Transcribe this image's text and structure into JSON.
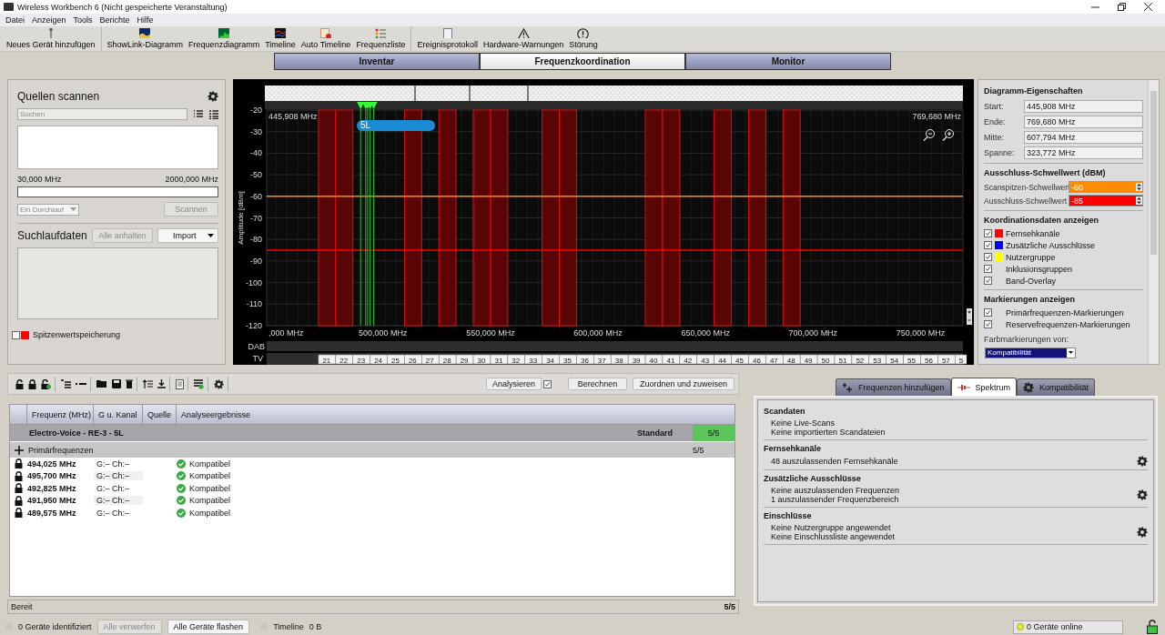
{
  "window": {
    "title": "Wireless Workbench 6 (Nicht gespeicherte Veranstaltung)"
  },
  "menu": [
    "Datei",
    "Anzeigen",
    "Tools",
    "Berichte",
    "Hilfe"
  ],
  "toolbar_groups": [
    [
      {
        "label": "Neues Gerät hinzufügen",
        "kind": "mic"
      }
    ],
    [
      {
        "label": "ShowLink-Diagramm",
        "kind": "showlink"
      },
      {
        "label": "Frequenzdiagramm",
        "kind": "spectrum"
      },
      {
        "label": "Timeline",
        "kind": "timeline"
      },
      {
        "label": "Auto Timeline",
        "kind": "autotimeline"
      },
      {
        "label": "Frequenzliste",
        "kind": "list"
      }
    ],
    [
      {
        "label": "Ereignisprotokoll",
        "kind": "log"
      },
      {
        "label": "Hardware-Warnungen",
        "kind": "warning"
      },
      {
        "label": "Störung",
        "kind": "alert"
      }
    ]
  ],
  "main_tabs": [
    {
      "label": "Inventar",
      "selected": false
    },
    {
      "label": "Frequenzkoordination",
      "selected": true
    },
    {
      "label": "Monitor",
      "selected": false
    }
  ],
  "scan_sources": {
    "title": "Quellen scannen",
    "search_placeholder": "Suchen",
    "range_start": "30,000 MHz",
    "range_end": "2000,000 MHz",
    "mode": {
      "value": "Ein Durchlauf",
      "disabled": true
    },
    "scan_button": {
      "label": "Scannen",
      "disabled": true
    }
  },
  "scan_data": {
    "title": "Suchlaufdaten",
    "stop_button": {
      "label": "Alle anhalten",
      "disabled": true
    },
    "import_button": "Import",
    "peak_hold": {
      "label": "Spitzenwertspeicherung",
      "checked": false,
      "color": "#ff0000"
    }
  },
  "spectrum": {
    "start_label": "445,908 MHz",
    "end_label": "769,680 MHz",
    "band_tag": "5L",
    "dab_label": "DAB",
    "tv_label": "TV",
    "tv_channels": [
      "21",
      "22",
      "23",
      "24",
      "25",
      "26",
      "27",
      "28",
      "29",
      "30",
      "31",
      "32",
      "33",
      "34",
      "35",
      "36",
      "37",
      "38",
      "39",
      "40",
      "41",
      "42",
      "43",
      "44",
      "45",
      "46",
      "47",
      "48",
      "49",
      "50",
      "51",
      "52",
      "53",
      "54",
      "55",
      "56",
      "57",
      "5"
    ],
    "cut_tick_label": ",000 MHz",
    "chart_data": {
      "type": "line",
      "ylabel": "Amplitude [dBm]",
      "grid": true,
      "xlim": [
        445908,
        769680
      ],
      "ylim": [
        -120,
        -20
      ],
      "xticks": [
        {
          "value": 500000,
          "label": "500,000 MHz"
        },
        {
          "value": 550000,
          "label": "550,000 MHz"
        },
        {
          "value": 600000,
          "label": "600,000 MHz"
        },
        {
          "value": 650000,
          "label": "650,000 MHz"
        },
        {
          "value": 700000,
          "label": "700,000 MHz"
        },
        {
          "value": 750000,
          "label": "750,000 MHz"
        }
      ],
      "yticks": [
        -20,
        -30,
        -40,
        -50,
        -60,
        -70,
        -80,
        -90,
        -100,
        -110,
        -120
      ],
      "ref_lines": [
        {
          "axis": "y",
          "value": -60,
          "color": "#ff8c00"
        },
        {
          "axis": "y",
          "value": -85,
          "color": "#ff0000"
        },
        {
          "axis": "x",
          "value": 489575,
          "color": "#22cc22"
        },
        {
          "axis": "x",
          "value": 491950,
          "color": "#22cc22"
        },
        {
          "axis": "x",
          "value": 492825,
          "color": "#22cc22"
        },
        {
          "axis": "x",
          "value": 494025,
          "color": "#22cc22"
        },
        {
          "axis": "x",
          "value": 495700,
          "color": "#22cc22"
        }
      ],
      "bands": [
        {
          "axis": "x",
          "from": 470000,
          "to": 478000,
          "color": "#5a0505"
        },
        {
          "axis": "x",
          "from": 478000,
          "to": 486000,
          "color": "#5a0505"
        },
        {
          "axis": "x",
          "from": 510000,
          "to": 518000,
          "color": "#5a0505"
        },
        {
          "axis": "x",
          "from": 526000,
          "to": 534000,
          "color": "#5a0505"
        },
        {
          "axis": "x",
          "from": 542000,
          "to": 550000,
          "color": "#5a0505"
        },
        {
          "axis": "x",
          "from": 550000,
          "to": 558000,
          "color": "#5a0505"
        },
        {
          "axis": "x",
          "from": 574000,
          "to": 582000,
          "color": "#5a0505"
        },
        {
          "axis": "x",
          "from": 582000,
          "to": 590000,
          "color": "#5a0505"
        },
        {
          "axis": "x",
          "from": 622000,
          "to": 630000,
          "color": "#5a0505"
        },
        {
          "axis": "x",
          "from": 630000,
          "to": 638000,
          "color": "#5a0505"
        },
        {
          "axis": "x",
          "from": 654000,
          "to": 662000,
          "color": "#5a0505"
        },
        {
          "axis": "x",
          "from": 670000,
          "to": 678000,
          "color": "#5a0505"
        },
        {
          "axis": "x",
          "from": 686000,
          "to": 694000,
          "color": "#5a0505"
        }
      ]
    }
  },
  "properties": {
    "title": "Diagramm-Eigenschaften",
    "fields": [
      {
        "label": "Start:",
        "value": "445,908 MHz"
      },
      {
        "label": "Ende:",
        "value": "769,680 MHz"
      },
      {
        "label": "Mitte:",
        "value": "607,794 MHz"
      },
      {
        "label": "Spanne:",
        "value": "323,772 MHz"
      }
    ],
    "threshold_title": "Ausschluss-Schwellwert (dBM)",
    "thresholds": [
      {
        "label": "Scanspitzen-Schwellwert",
        "value": "-60",
        "color": "#ff8c00"
      },
      {
        "label": "Ausschluss-Schwellwert",
        "value": "-85",
        "color": "#ff0000"
      }
    ],
    "coord_title": "Koordinationsdaten anzeigen",
    "coord_items": [
      {
        "label": "Fernsehkanäle",
        "checked": true,
        "color": "#ff0000"
      },
      {
        "label": "Zusätzliche Ausschlüsse",
        "checked": true,
        "color": "#0000ff"
      },
      {
        "label": "Nutzergruppe",
        "checked": true,
        "color": "#ffff00"
      },
      {
        "label": "Inklusionsgruppen",
        "checked": true
      },
      {
        "label": "Band-Overlay",
        "checked": true
      }
    ],
    "markers_title": "Markierungen anzeigen",
    "marker_items": [
      {
        "label": "Primärfrequenzen-Markierungen",
        "checked": true
      },
      {
        "label": "Reservefrequenzen-Markierungen",
        "checked": true
      }
    ],
    "color_by_label": "Farbmarkierungen von:",
    "color_by_value": "Kompatibilität"
  },
  "coord_toolbar": {
    "analyze_button": "Analysieren",
    "analyze_checked": true,
    "calc_button": "Berechnen",
    "assign_button": "Zuordnen und zuweisen"
  },
  "table": {
    "columns": [
      "Frequenz (MHz)",
      "G u. Kanal",
      "Quelle",
      "Analyseergebnisse"
    ],
    "group": {
      "name": "Electro-Voice - RE-3 - 5L",
      "profile": "Standard",
      "count": "5/5"
    },
    "subgroup": {
      "label": "Primärfrequenzen",
      "count": "5/5"
    },
    "rows": [
      {
        "frequency": "494,025 MHz",
        "channel": "G:– Ch:–",
        "result": "Kompatibel",
        "locked": true
      },
      {
        "frequency": "495,700 MHz",
        "channel": "G:– Ch:–",
        "result": "Kompatibel",
        "locked": true
      },
      {
        "frequency": "492,825 MHz",
        "channel": "G:– Ch:–",
        "result": "Kompatibel",
        "locked": true
      },
      {
        "frequency": "491,950 MHz",
        "channel": "G:– Ch:–",
        "result": "Kompatibel",
        "locked": true
      },
      {
        "frequency": "489,575 MHz",
        "channel": "G:– Ch:–",
        "result": "Kompatibel",
        "locked": true
      }
    ]
  },
  "table_status": {
    "text": "Bereit",
    "count": "5/5"
  },
  "side_tabs": [
    {
      "label": "Frequenzen hinzufügen",
      "selected": false
    },
    {
      "label": "Spektrum",
      "selected": true
    },
    {
      "label": "Kompatibilität",
      "selected": false
    }
  ],
  "sections": [
    {
      "title": "Scandaten",
      "lines": [
        "Keine Live-Scans",
        "Keine importierten Scandateien"
      ],
      "settings": false
    },
    {
      "title": "Fernsehkanäle",
      "lines": [
        "48 auszulassenden Fernsehkanäle"
      ],
      "settings": true
    },
    {
      "title": "Zusätzliche Ausschlüsse",
      "lines": [
        "Keine auszulassenden Frequenzen",
        "1 auszulassender Frequenzbereich"
      ],
      "settings": true
    },
    {
      "title": "Einschlüsse",
      "lines": [
        "Keine Nutzergruppe angewendet",
        "Keine Einschlussliste angewendet"
      ],
      "settings": true
    }
  ],
  "status_bar": {
    "identified": "0 Geräte identifiziert",
    "discard_button": {
      "label": "Alle verwerfen",
      "disabled": true
    },
    "flash_button": "Alle Geräte flashen",
    "timeline": "Timeline",
    "timeline_size": "0 B",
    "online": "0 Geräte online"
  }
}
